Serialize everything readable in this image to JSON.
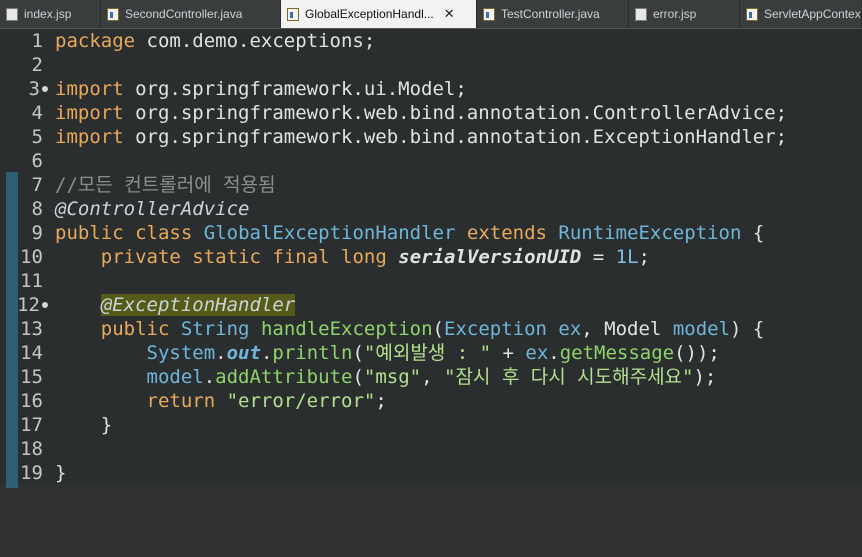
{
  "tabs": [
    {
      "label": "index.jsp",
      "type": "jsp"
    },
    {
      "label": "SecondController.java",
      "type": "java"
    },
    {
      "label": "GlobalExceptionHandl...",
      "type": "java",
      "active": true
    },
    {
      "label": "TestController.java",
      "type": "java"
    },
    {
      "label": "error.jsp",
      "type": "jsp"
    },
    {
      "label": "ServletAppContext.java",
      "type": "java"
    }
  ],
  "line_numbers": [
    "1",
    "2",
    "3",
    "4",
    "5",
    "6",
    "7",
    "8",
    "9",
    "10",
    "11",
    "12",
    "13",
    "14",
    "15",
    "16",
    "17",
    "18",
    "19"
  ],
  "code": {
    "l1": {
      "kw": "package",
      "rest": " com.demo.exceptions;"
    },
    "l3": {
      "kw": "import",
      "rest": " org.springframework.ui.Model;"
    },
    "l4": {
      "kw": "import",
      "rest": " org.springframework.web.bind.annotation.ControllerAdvice;"
    },
    "l5": {
      "kw": "import",
      "rest": " org.springframework.web.bind.annotation.ExceptionHandler;"
    },
    "l7": {
      "comment": "//모든 컨트롤러에 적용됨"
    },
    "l8": {
      "annotation": "@ControllerAdvice"
    },
    "l9": {
      "kw1": "public",
      "kw2": "class",
      "name": "GlobalExceptionHandler",
      "kw3": "extends",
      "super": "RuntimeException",
      "brace": " {"
    },
    "l10": {
      "kw1": "private",
      "kw2": "static",
      "kw3": "final",
      "kw4": "long",
      "field": "serialVersionUID",
      "eq": " = ",
      "num": "1L",
      "semi": ";"
    },
    "l12": {
      "annotation": "@ExceptionHandler"
    },
    "l13": {
      "kw": "public",
      "type": "String",
      "method": "handleException",
      "p1": "(",
      "ptype": "Exception",
      "pname": " ex",
      "comma": ", ",
      "ptype2": "Model",
      "pname2": " model",
      "end": ") {"
    },
    "l14": {
      "cls": "System",
      "dot": ".",
      "fld": "out",
      "dot2": ".",
      "m": "println",
      "open": "(",
      "str": "\"예외발생 : \"",
      "plus": " + ",
      "obj": "ex",
      "dot3": ".",
      "m2": "getMessage",
      "close": "());"
    },
    "l15": {
      "obj": "model",
      "dot": ".",
      "m": "addAttribute",
      "open": "(",
      "s1": "\"msg\"",
      "comma": ", ",
      "s2": "\"잠시 후 다시 시도해주세요\"",
      "close": ");"
    },
    "l16": {
      "kw": "return",
      "str": "\"error/error\"",
      "semi": ";"
    },
    "l17": {
      "brace": "}"
    },
    "l19": {
      "brace": "}"
    }
  }
}
